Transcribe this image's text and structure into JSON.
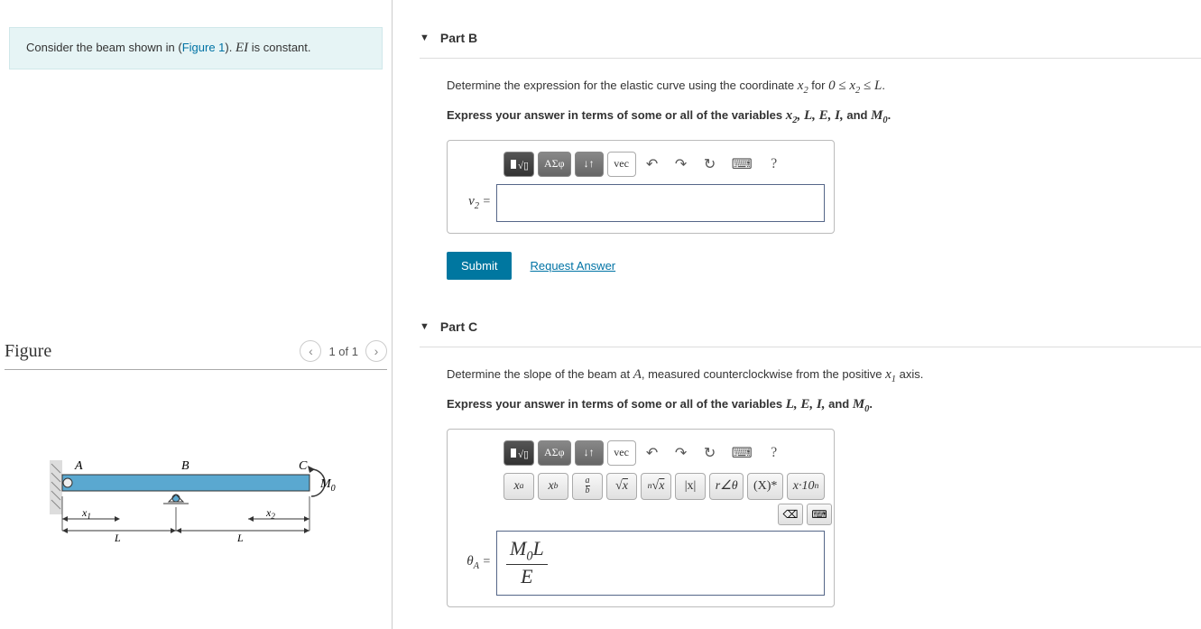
{
  "intro": {
    "prefix": "Consider the beam shown in (",
    "figure_link": "Figure 1",
    "suffix": "). ",
    "ei": "EI",
    "constant": " is constant."
  },
  "figure": {
    "title": "Figure",
    "pager": "1 of 1",
    "labels": {
      "A": "A",
      "B": "B",
      "C": "C",
      "M0": "M",
      "M0sub": "0",
      "x1": "x",
      "x1sub": "1",
      "x2": "x",
      "x2sub": "2",
      "L": "L"
    }
  },
  "partB": {
    "title": "Part B",
    "q_prefix": "Determine the expression for the elastic curve using the coordinate ",
    "q_var": "x",
    "q_varsub": "2",
    "q_middle": " for ",
    "q_range": "0 ≤ x₂ ≤ L",
    "q_suffix": ".",
    "instr_prefix": "Express your answer in terms of some or all of the variables ",
    "instr_vars": "x₂, L, E, I,",
    "instr_and": " and ",
    "instr_m0": "M₀",
    "instr_suffix": ".",
    "label": "v",
    "labelsub": "2",
    "eq": " = "
  },
  "partC": {
    "title": "Part C",
    "q_prefix": "Determine the slope of the beam at ",
    "q_A": "A",
    "q_middle": ", measured counterclockwise from the positive ",
    "q_var": "x",
    "q_varsub": "1",
    "q_suffix": " axis.",
    "instr_prefix": "Express your answer in terms of some or all of the variables ",
    "instr_vars": "L, E, I,",
    "instr_and": " and ",
    "instr_m0": "M₀",
    "instr_suffix": ".",
    "label": "θ",
    "labelsub": "A",
    "eq": " = ",
    "answer_num": "M₀L",
    "answer_den": "E"
  },
  "toolbar": {
    "templates": "▮√̅▯",
    "greek": "ΑΣφ",
    "sort": "↓↑",
    "vec": "vec",
    "undo": "↶",
    "redo": "↷",
    "reset": "↻",
    "keyboard": "⌨",
    "help": "?"
  },
  "subtoolbar": {
    "xa": "xᵃ",
    "xb": "xᵇ",
    "frac": "a/b",
    "sqrt": "√x",
    "nsqrt": "ⁿ√x",
    "abs": "|x|",
    "angle": "r∠θ",
    "conj": "(X)*",
    "sci": "x·10ⁿ",
    "backspace": "⌫",
    "keyboard": "⌨"
  },
  "actions": {
    "submit": "Submit",
    "request": "Request Answer"
  }
}
